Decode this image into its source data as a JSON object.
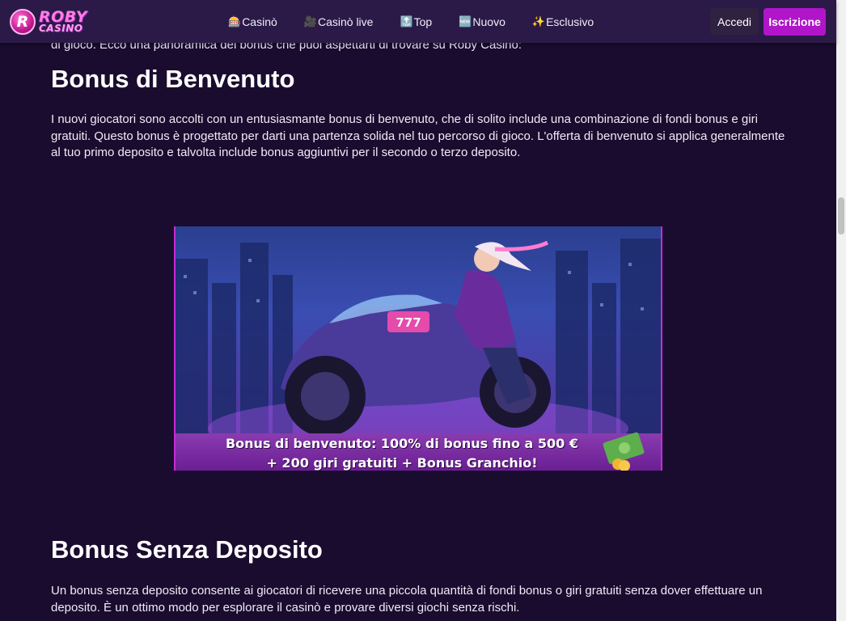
{
  "brand": {
    "logo_letter": "R",
    "name_top": "ROBY",
    "name_bottom": "CASINO"
  },
  "nav": [
    {
      "icon": "🎰",
      "label": "Casinò"
    },
    {
      "icon": "🎥",
      "label": "Casinò live"
    },
    {
      "icon": "🔝",
      "label": "Top"
    },
    {
      "icon": "🆕",
      "label": "Nuovo"
    },
    {
      "icon": "✨",
      "label": "Esclusivo"
    }
  ],
  "auth": {
    "login": "Accedi",
    "signup": "Iscrizione"
  },
  "article": {
    "intro_tail": "di gioco. Ecco una panoramica dei bonus che puoi aspettarti di trovare su Roby Casino:",
    "welcome_heading": "Bonus di Benvenuto",
    "welcome_text": "I nuovi giocatori sono accolti con un entusiasmante bonus di benvenuto, che di solito include una combinazione di fondi bonus e giri gratuiti. Questo bonus è progettato per darti una partenza solida nel tuo percorso di gioco. L'offerta di benvenuto si applica generalmente al tuo primo deposito e talvolta include bonus aggiuntivi per il secondo o terzo deposito.",
    "banner": {
      "caption_line1": "Bonus di benvenuto: 100% di bonus fino a 500 €",
      "caption_line2": "+ 200 giri gratuiti + Bonus Granchio!",
      "plate": "777"
    },
    "nodeposit_heading": "Bonus Senza Deposito",
    "nodeposit_text": "Un bonus senza deposito consente ai giocatori di ricevere una piccola quantità di fondi bonus o giri gratuiti senza dover effettuare un deposito. È un ottimo modo per esplorare il casinò e provare diversi giochi senza rischi."
  },
  "colors": {
    "background": "#1a0c2e",
    "header": "#2b1a47",
    "accent": "#b015c9"
  }
}
